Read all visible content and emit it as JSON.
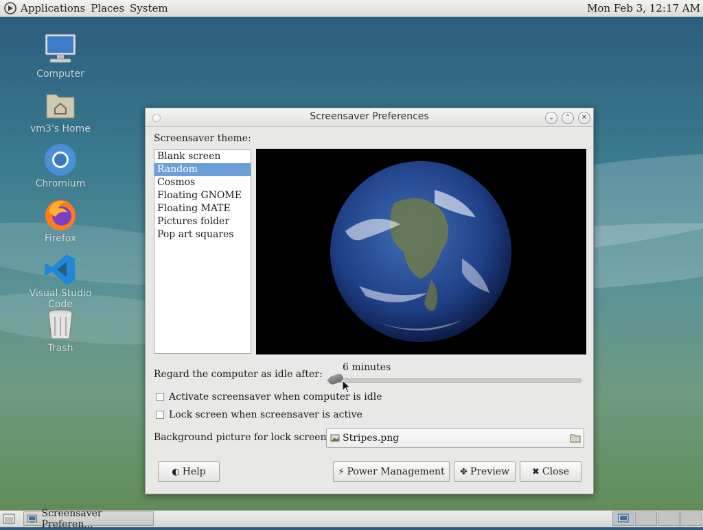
{
  "top_panel": {
    "menus": [
      "Applications",
      "Places",
      "System"
    ],
    "clock": "Mon Feb  3, 12:17 AM"
  },
  "desktop": {
    "icons": [
      {
        "label": "Computer",
        "icon": "computer-icon"
      },
      {
        "label": "vm3's Home",
        "icon": "home-folder-icon"
      },
      {
        "label": "Chromium",
        "icon": "chromium-icon"
      },
      {
        "label": "Firefox",
        "icon": "firefox-icon"
      },
      {
        "label": "Visual Studio Code",
        "icon": "vscode-icon"
      },
      {
        "label": "Trash",
        "icon": "trash-icon"
      }
    ]
  },
  "window": {
    "title": "Screensaver Preferences",
    "theme_label": "Screensaver theme:",
    "themes": [
      "Blank screen",
      "Random",
      "Cosmos",
      "Floating GNOME",
      "Floating MATE",
      "Pictures folder",
      "Pop art squares"
    ],
    "selected_theme": "Random",
    "idle_label": "Regard the computer as idle after:",
    "idle_value": "6 minutes",
    "activate_label": "Activate screensaver when computer is idle",
    "activate_checked": false,
    "lock_label": "Lock screen when screensaver is active",
    "lock_checked": false,
    "bg_label": "Background picture for lock screen:",
    "bg_file": "Stripes.png",
    "buttons": {
      "help": "Help",
      "power": "Power Management",
      "preview": "Preview",
      "close": "Close"
    }
  },
  "bottom_panel": {
    "task_label": "Screensaver Preferen..."
  },
  "colors": {
    "selection": "#6a9fd8",
    "window_bg": "#e8e8e6"
  }
}
